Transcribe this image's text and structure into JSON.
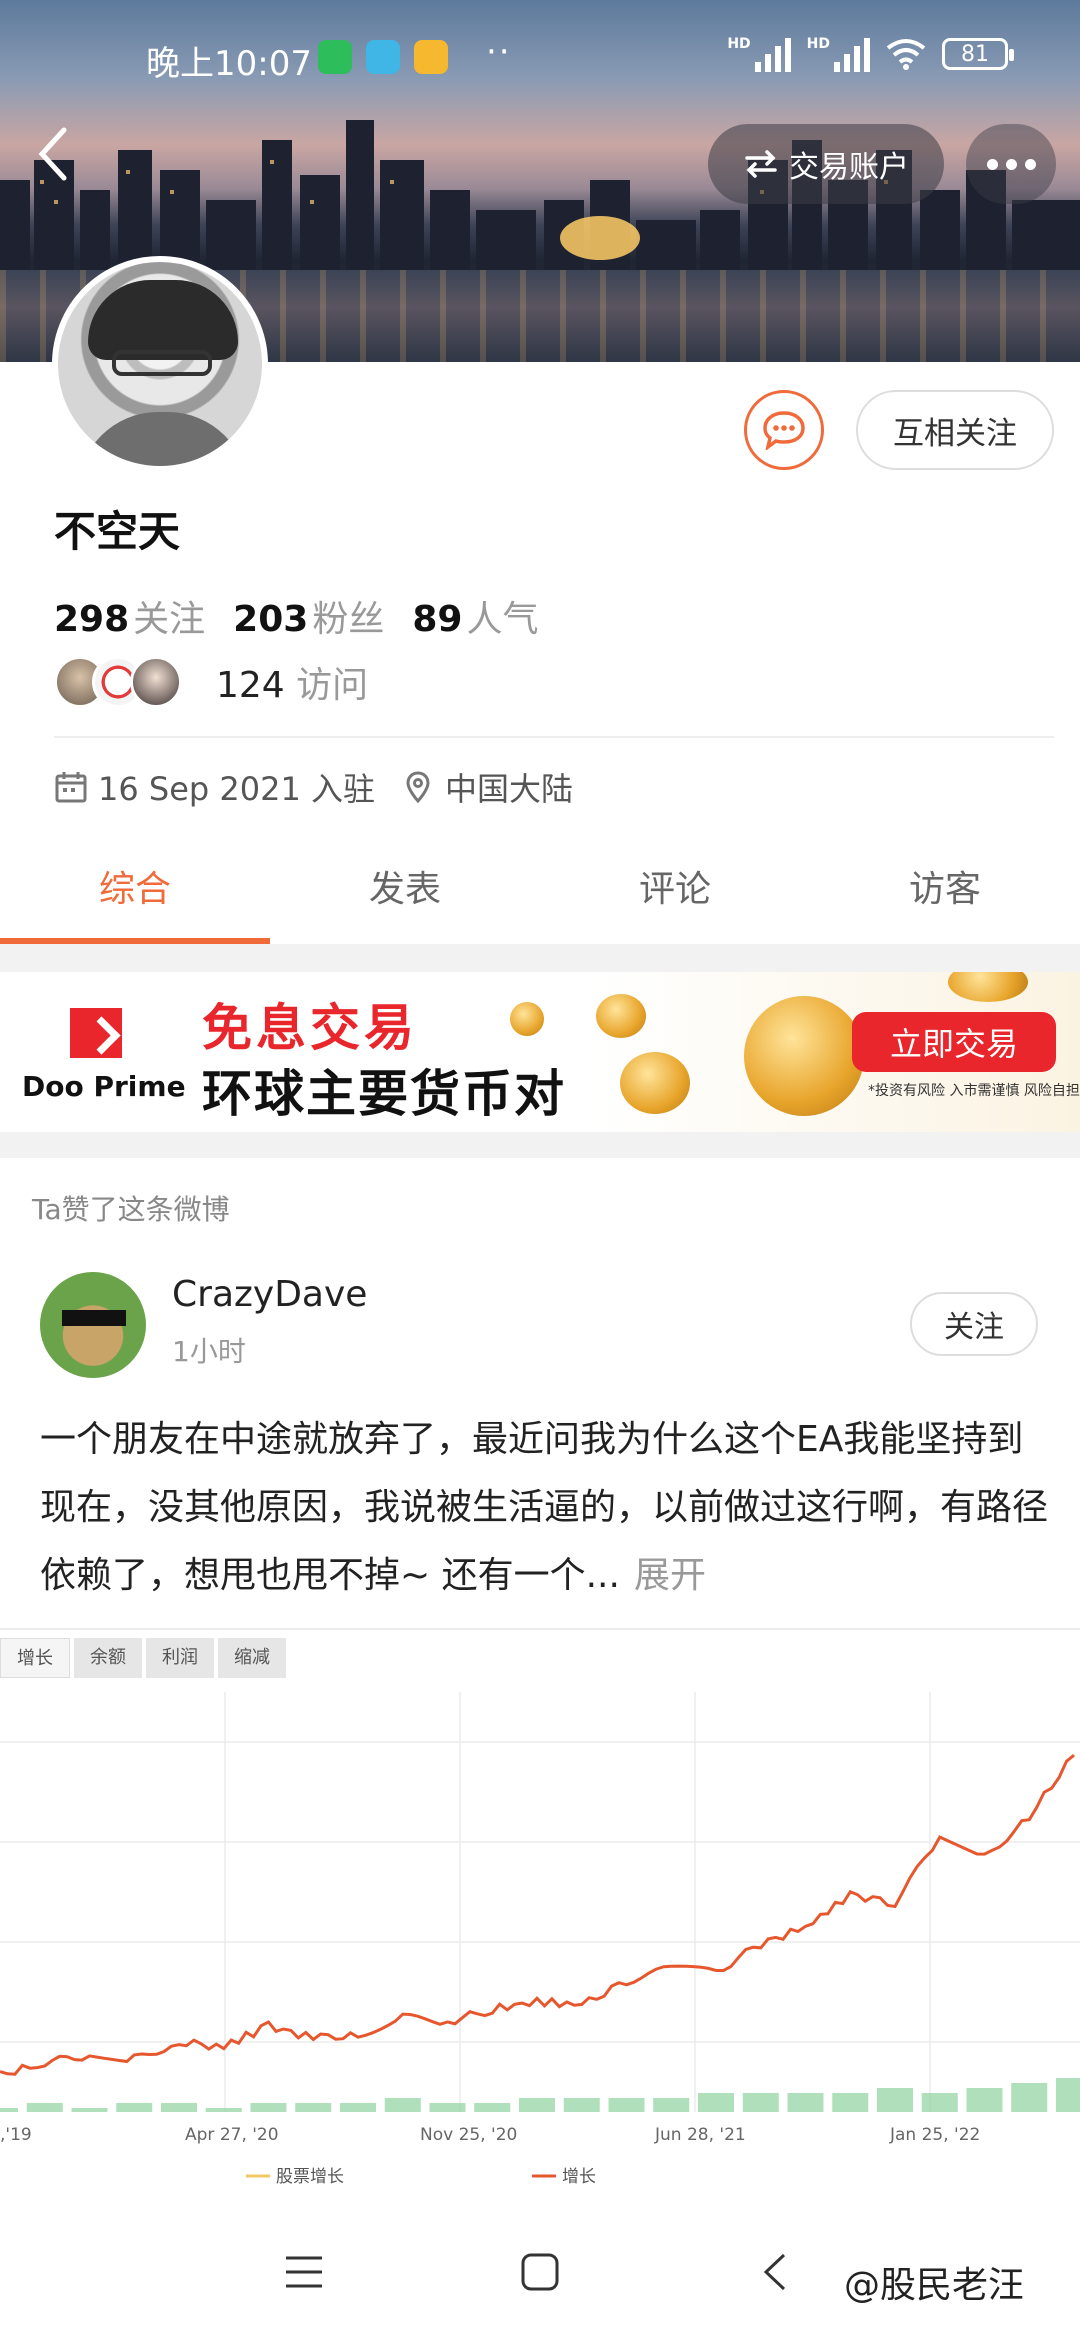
{
  "status": {
    "time": "晚上10:07",
    "more": "··",
    "hd1": "HD",
    "hd2": "HD",
    "battery": "81"
  },
  "header": {
    "account_label": "交易账户"
  },
  "profile": {
    "name": "不空天",
    "stats": [
      {
        "num": "298",
        "label": "关注"
      },
      {
        "num": "203",
        "label": "粉丝"
      },
      {
        "num": "89",
        "label": "人气"
      }
    ],
    "visits_num": "124",
    "visits_label": "访问",
    "join_date": "16 Sep 2021 入驻",
    "location": "中国大陆",
    "mutual_follow": "互相关注"
  },
  "tabs": [
    {
      "label": "综合",
      "active": true
    },
    {
      "label": "发表",
      "active": false
    },
    {
      "label": "评论",
      "active": false
    },
    {
      "label": "访客",
      "active": false
    }
  ],
  "ad": {
    "brand": "Doo Prime",
    "title": "免息交易",
    "subtitle": "环球主要货币对",
    "cta": "立即交易",
    "disclaimer": "*投资有风险 入市需谨慎 风险自担"
  },
  "post": {
    "liked_note": "Ta赞了这条微博",
    "author": "CrazyDave",
    "time": "1小时",
    "follow": "关注",
    "text": "一个朋友在中途就放弃了，最近问我为什么这个EA我能坚持到现在，没其他原因，我说被生活逼的，以前做过这行啊，有路径依赖了，想甩也甩不掉~ 还有一个...",
    "expand": "展开"
  },
  "chart_image": {
    "tabs": [
      "增长",
      "余额",
      "利润",
      "缩减"
    ],
    "legend": [
      "股票增长",
      "增长"
    ]
  },
  "chart_data": {
    "type": "line",
    "x": [
      ",'19",
      "Apr 27, '20",
      "Nov 25, '20",
      "Jun 28, '21",
      "Jan 25, '22"
    ],
    "series": [
      {
        "name": "增长",
        "values": [
          2,
          5,
          7,
          6,
          10,
          9,
          14,
          11,
          12,
          16,
          15,
          18,
          20,
          19,
          25,
          28,
          27,
          34,
          38,
          46,
          44,
          60,
          55,
          65,
          80
        ]
      },
      {
        "name": "股票增长",
        "values": [
          0,
          1,
          0,
          1,
          1,
          0,
          1,
          1,
          1,
          2,
          1,
          1,
          2,
          2,
          2,
          2,
          3,
          3,
          3,
          3,
          4,
          3,
          4,
          5,
          6
        ]
      }
    ],
    "colors": {
      "line": "#e6572e",
      "bars": "#8fd19e"
    }
  },
  "watermark": "@股民老汪"
}
